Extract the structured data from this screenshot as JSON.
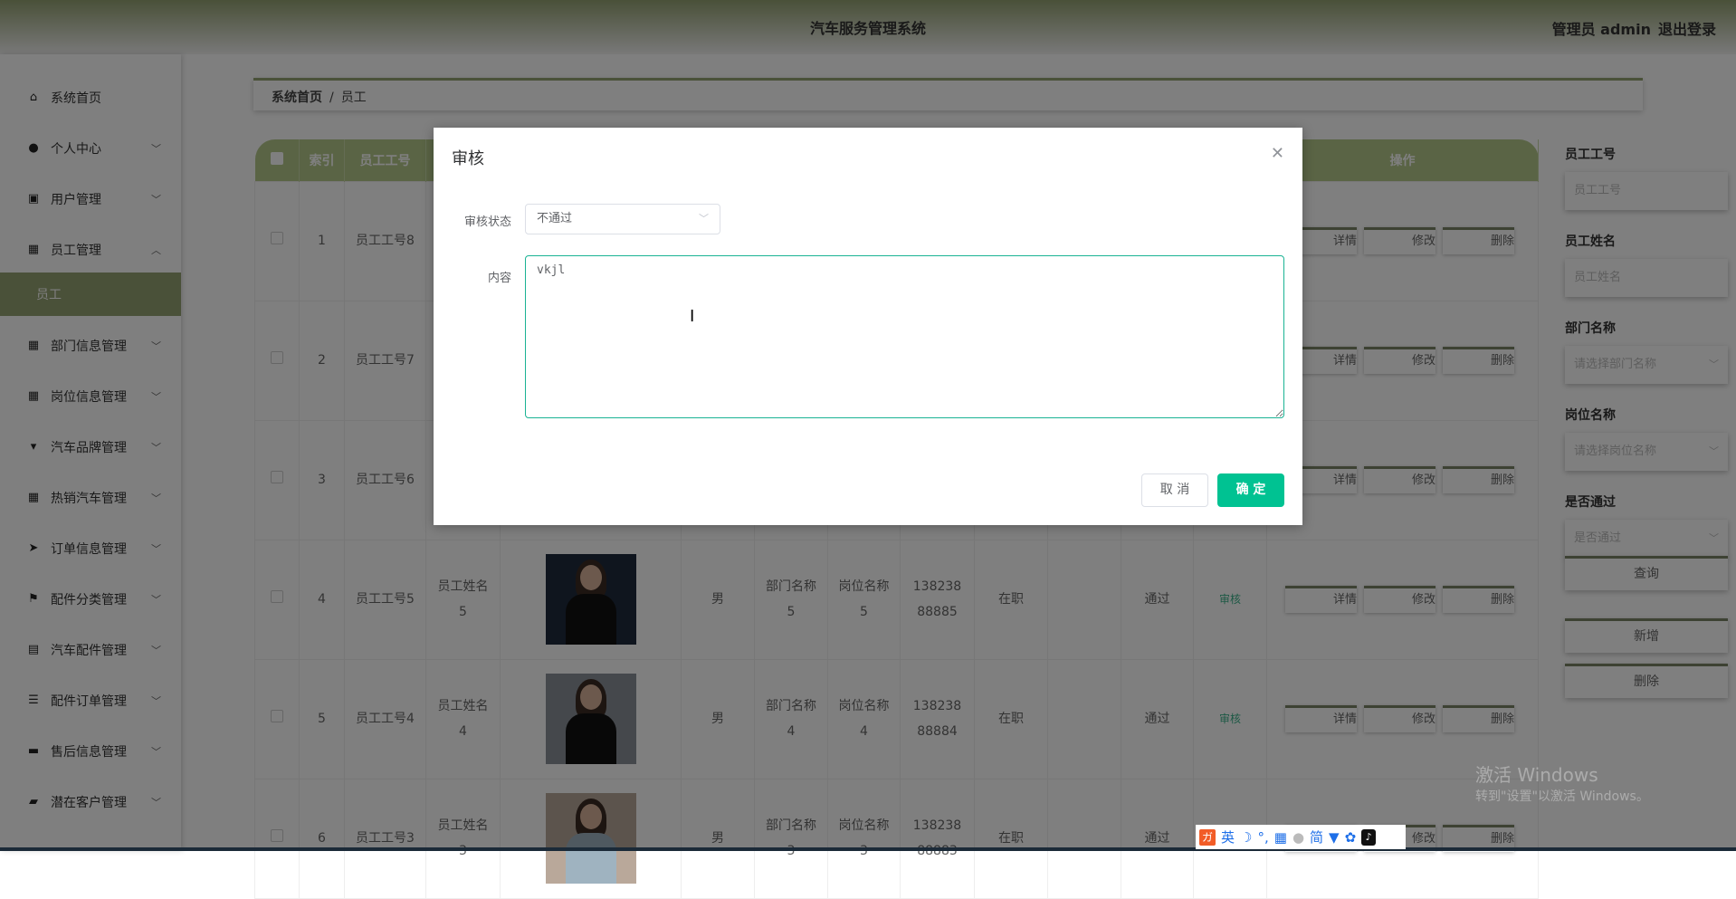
{
  "header": {
    "title": "汽车服务管理系统",
    "user": "管理员 admin",
    "logout": "退出登录"
  },
  "sidebar": {
    "items": [
      {
        "label": "系统首页",
        "icon": "home-icon",
        "glyph": "⌂",
        "expand": ""
      },
      {
        "label": "个人中心",
        "icon": "user-icon",
        "glyph": "●",
        "expand": "﹀"
      },
      {
        "label": "用户管理",
        "icon": "clipboard-icon",
        "glyph": "▣",
        "expand": "﹀"
      },
      {
        "label": "员工管理",
        "icon": "grid-icon",
        "glyph": "▦",
        "expand": "︿"
      },
      {
        "label": "部门信息管理",
        "icon": "grid-icon",
        "glyph": "▦",
        "expand": "﹀"
      },
      {
        "label": "岗位信息管理",
        "icon": "grid-icon",
        "glyph": "▦",
        "expand": "﹀"
      },
      {
        "label": "汽车品牌管理",
        "icon": "sign-icon",
        "glyph": "▾",
        "expand": "﹀"
      },
      {
        "label": "热销汽车管理",
        "icon": "grid-icon",
        "glyph": "▦",
        "expand": "﹀"
      },
      {
        "label": "订单信息管理",
        "icon": "send-icon",
        "glyph": "➤",
        "expand": "﹀"
      },
      {
        "label": "配件分类管理",
        "icon": "flag-icon",
        "glyph": "⚑",
        "expand": "﹀"
      },
      {
        "label": "汽车配件管理",
        "icon": "chart-icon",
        "glyph": "▤",
        "expand": "﹀"
      },
      {
        "label": "配件订单管理",
        "icon": "list-icon",
        "glyph": "☰",
        "expand": "﹀"
      },
      {
        "label": "售后信息管理",
        "icon": "message-icon",
        "glyph": "▬",
        "expand": "﹀"
      },
      {
        "label": "潜在客户管理",
        "icon": "ticket-icon",
        "glyph": "▰",
        "expand": "﹀"
      }
    ],
    "active_sub": "员工"
  },
  "breadcrumb": {
    "home": "系统首页",
    "sep": "/",
    "current": "员工"
  },
  "table": {
    "headers": {
      "index": "索引",
      "emp_no": "员工工号",
      "ops": "操作"
    },
    "rows": [
      {
        "index": "1",
        "emp_no": "员工工号8",
        "name": "",
        "dept": "",
        "post": "",
        "gender": "",
        "phone": "",
        "status": "",
        "pass": "",
        "audit": "",
        "photo": ""
      },
      {
        "index": "2",
        "emp_no": "员工工号7",
        "name": "",
        "dept": "",
        "post": "",
        "gender": "",
        "phone": "",
        "status": "",
        "pass": "",
        "audit": "",
        "photo": ""
      },
      {
        "index": "3",
        "emp_no": "员工工号6",
        "name": "",
        "dept": "",
        "post": "",
        "gender": "",
        "phone": "",
        "status": "",
        "pass": "",
        "audit": "",
        "photo": ""
      },
      {
        "index": "4",
        "emp_no": "员工工号5",
        "name": "员工姓名5",
        "dept": "部门名称5",
        "post": "岗位名称5",
        "gender": "男",
        "phone": "13823888885",
        "status": "在职",
        "pass": "通过",
        "audit": "审核",
        "photo": "#1f2a3c"
      },
      {
        "index": "5",
        "emp_no": "员工工号4",
        "name": "员工姓名4",
        "dept": "部门名称4",
        "post": "岗位名称4",
        "gender": "男",
        "phone": "13823888884",
        "status": "在职",
        "pass": "通过",
        "audit": "审核",
        "photo": "#8a9098"
      },
      {
        "index": "6",
        "emp_no": "员工工号3",
        "name": "员工姓名3",
        "dept": "部门名称3",
        "post": "岗位名称3",
        "gender": "男",
        "phone": "13823888883",
        "status": "在职",
        "pass": "通过",
        "audit": "",
        "photo": "#b9a89a"
      }
    ],
    "ops": {
      "detail": "详情",
      "edit": "修改",
      "delete": "删除"
    }
  },
  "search": {
    "fields": [
      {
        "label": "员工工号",
        "placeholder": "员工工号",
        "select": false
      },
      {
        "label": "员工姓名",
        "placeholder": "员工姓名",
        "select": false
      },
      {
        "label": "部门名称",
        "placeholder": "请选择部门名称",
        "select": true
      },
      {
        "label": "岗位名称",
        "placeholder": "请选择岗位名称",
        "select": true
      },
      {
        "label": "是否通过",
        "placeholder": "是否通过",
        "select": true
      }
    ],
    "query": "查询",
    "add": "新增",
    "delete": "删除"
  },
  "dialog": {
    "title": "审核",
    "status_label": "审核状态",
    "status_value": "不通过",
    "content_label": "内容",
    "content_value": "vkjl",
    "cancel": "取 消",
    "confirm": "确 定"
  },
  "watermark": {
    "line1": "激活 Windows",
    "line2": "转到\"设置\"以激活 Windows。"
  },
  "ime": {
    "lang": "英",
    "mode": "简"
  }
}
